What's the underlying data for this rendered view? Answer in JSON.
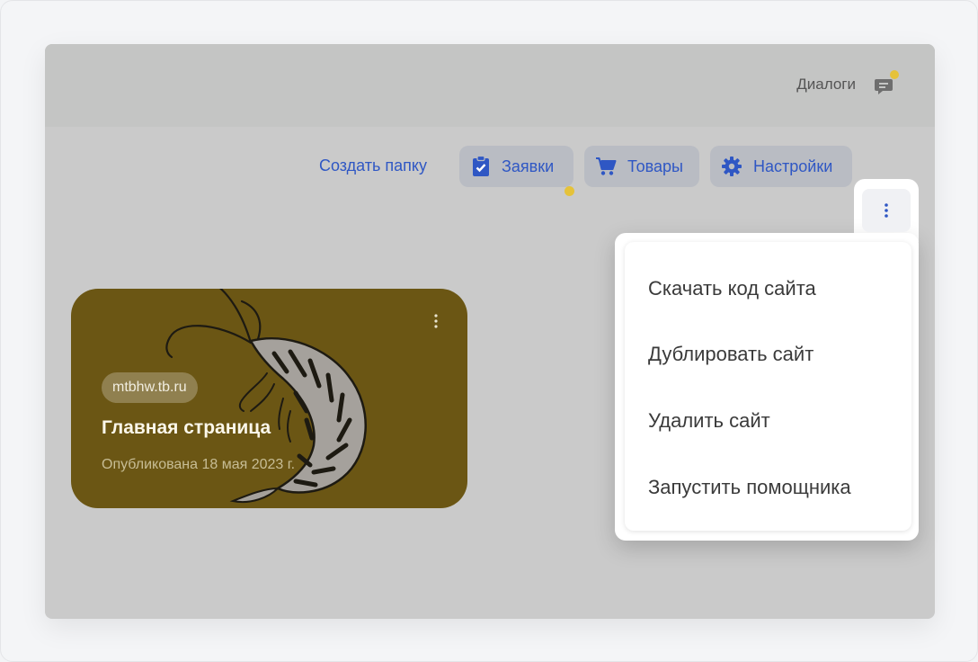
{
  "header": {
    "dialogs_label": "Диалоги",
    "dialogs_icon": "chat-icon",
    "notification_color": "#e5c23a"
  },
  "toolbar": {
    "create_folder": "Создать папку",
    "requests": {
      "label": "Заявки",
      "icon": "clipboard-check-icon",
      "has_notification": true
    },
    "products": {
      "label": "Товары",
      "icon": "cart-icon"
    },
    "settings": {
      "label": "Настройки",
      "icon": "gear-icon"
    },
    "more_icon": "more-vertical-icon",
    "accent_color": "#2f57c4"
  },
  "menu": {
    "items": [
      {
        "label": "Скачать код сайта"
      },
      {
        "label": "Дублировать сайт"
      },
      {
        "label": "Удалить сайт"
      },
      {
        "label": "Запустить помощника"
      }
    ]
  },
  "site_card": {
    "domain": "mtbhw.tb.ru",
    "title": "Главная страница",
    "published": "Опубликована 18 мая 2023 г.",
    "cover_icon": "shrimp-illustration",
    "cover_color": "#6b5614"
  }
}
